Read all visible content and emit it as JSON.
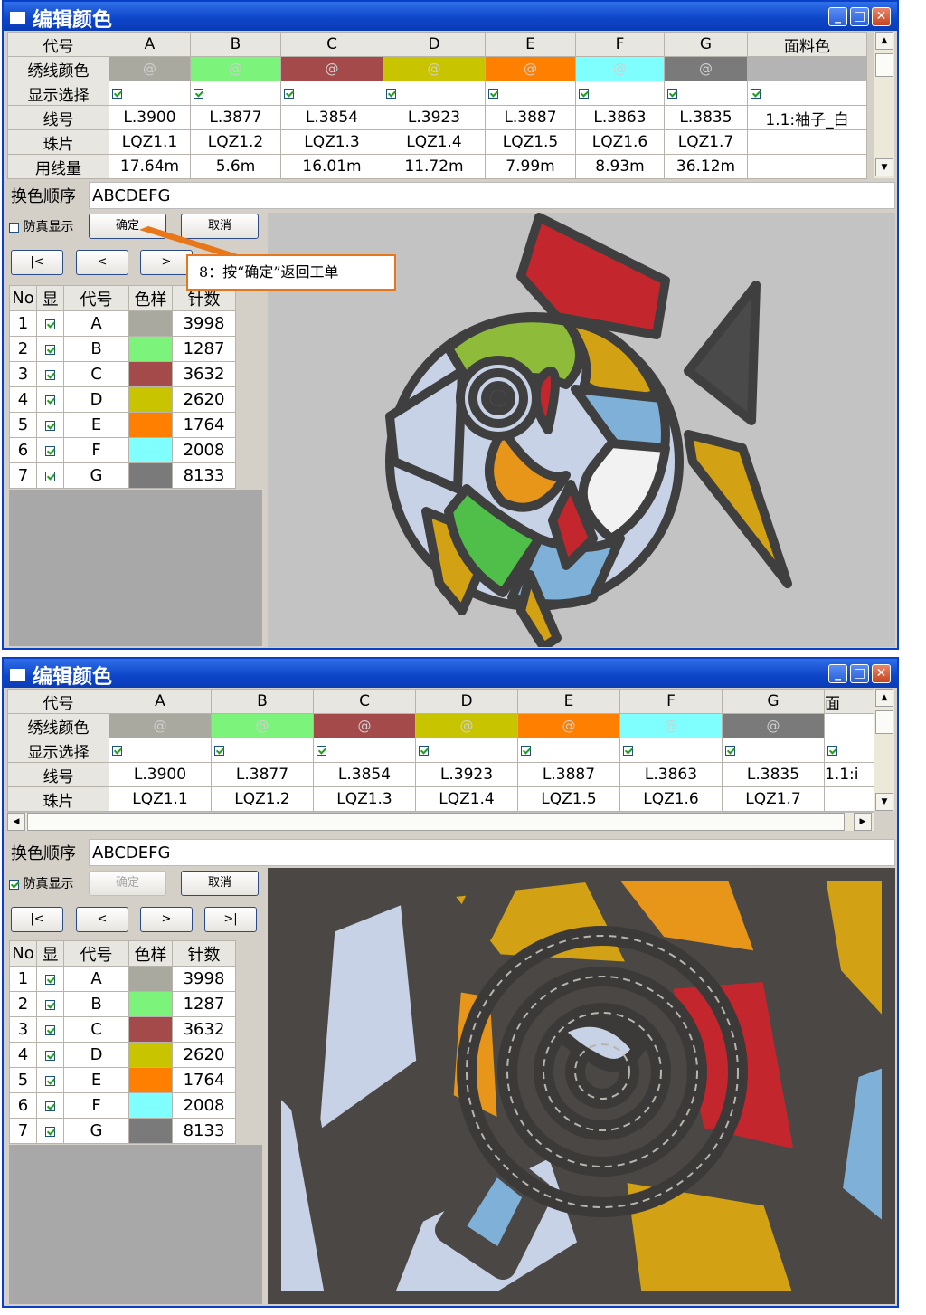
{
  "window_title": "编辑颜色",
  "title_buttons": {
    "minimize": "_",
    "maximize": "□",
    "close": "✕"
  },
  "grid_top": {
    "row_labels": [
      "代号",
      "绣线颜色",
      "显示选择",
      "线号",
      "珠片",
      "用线量"
    ],
    "columns": [
      {
        "code": "A",
        "swatch": "#a9a9a0",
        "swatch_text": "@",
        "thread": "L.3900",
        "bead": "LQZ1.1",
        "usage": "17.64m"
      },
      {
        "code": "B",
        "swatch": "#7cf47c",
        "swatch_text": "@",
        "thread": "L.3877",
        "bead": "LQZ1.2",
        "usage": "5.6m"
      },
      {
        "code": "C",
        "swatch": "#a44a4a",
        "swatch_text": "@",
        "thread": "L.3854",
        "bead": "LQZ1.3",
        "usage": "16.01m"
      },
      {
        "code": "D",
        "swatch": "#c9c400",
        "swatch_text": "@",
        "thread": "L.3923",
        "bead": "LQZ1.4",
        "usage": "11.72m"
      },
      {
        "code": "E",
        "swatch": "#ff8000",
        "swatch_text": "@",
        "thread": "L.3887",
        "bead": "LQZ1.5",
        "usage": "7.99m"
      },
      {
        "code": "F",
        "swatch": "#80ffff",
        "swatch_text": "@",
        "thread": "L.3863",
        "bead": "LQZ1.6",
        "usage": "8.93m"
      },
      {
        "code": "G",
        "swatch": "#7a7a7a",
        "swatch_text": "@",
        "thread": "L.3835",
        "bead": "LQZ1.7",
        "usage": "36.12m"
      },
      {
        "code": "面料色",
        "swatch": "#b4b4b4",
        "swatch_text": "",
        "thread": "1.1:袖子_白",
        "bead": "",
        "usage": ""
      }
    ]
  },
  "grid_bottom": {
    "row_labels": [
      "代号",
      "绣线颜色",
      "显示选择",
      "线号",
      "珠片"
    ],
    "last_col_code": "面",
    "last_col_thread": "1.1:i"
  },
  "sequence": {
    "label": "换色顺序",
    "value": "ABCDEFG"
  },
  "sim_display_label": "防真显示",
  "sim_display_checked_top": false,
  "sim_display_checked_bottom": true,
  "buttons": {
    "ok": "确定",
    "cancel": "取消",
    "first": "|<",
    "prev": "<",
    "next": ">",
    "last": ">|"
  },
  "list": {
    "headers": [
      "No",
      "显",
      "代号",
      "色样",
      "针数"
    ],
    "rows": [
      {
        "no": "1",
        "code": "A",
        "color": "#a9a9a0",
        "stitches": "3998"
      },
      {
        "no": "2",
        "code": "B",
        "color": "#7cf47c",
        "stitches": "1287"
      },
      {
        "no": "3",
        "code": "C",
        "color": "#a44a4a",
        "stitches": "3632"
      },
      {
        "no": "4",
        "code": "D",
        "color": "#c9c400",
        "stitches": "2620"
      },
      {
        "no": "5",
        "code": "E",
        "color": "#ff8000",
        "stitches": "1764"
      },
      {
        "no": "6",
        "code": "F",
        "color": "#80ffff",
        "stitches": "2008"
      },
      {
        "no": "7",
        "code": "G",
        "color": "#7a7a7a",
        "stitches": "8133"
      }
    ]
  },
  "callout": "8：按“确定”返回工单"
}
